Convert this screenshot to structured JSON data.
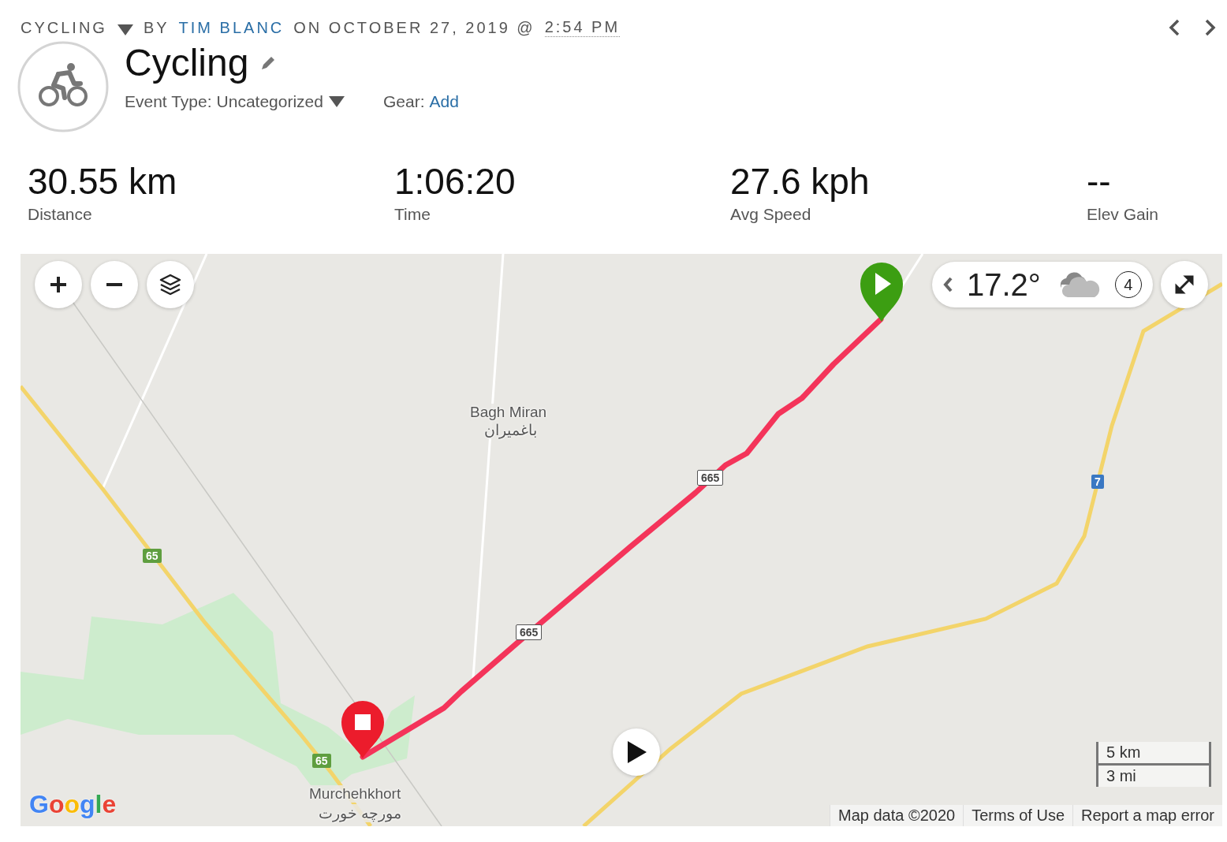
{
  "breadcrumb": {
    "activity": "CYCLING",
    "by": "BY",
    "author": "TIM BLANC",
    "date": "ON OCTOBER 27, 2019 @",
    "time": "2:54 PM"
  },
  "title": "Cycling",
  "event_type": {
    "label": "Event Type:",
    "value": "Uncategorized"
  },
  "gear": {
    "label": "Gear:",
    "value": "Add"
  },
  "stats": [
    {
      "value": "30.55 km",
      "label": "Distance"
    },
    {
      "value": "1:06:20",
      "label": "Time"
    },
    {
      "value": "27.6 kph",
      "label": "Avg Speed"
    },
    {
      "value": "--",
      "label": "Elev Gain"
    }
  ],
  "map": {
    "weather": {
      "temperature": "17.2°",
      "wind": "4"
    },
    "labels": [
      {
        "kind": "place",
        "text": "Bagh Miran"
      },
      {
        "kind": "place",
        "text": "باغمیران"
      },
      {
        "kind": "place",
        "text": "Murchehkhort"
      },
      {
        "kind": "place",
        "text": "مورچه خورت"
      },
      {
        "kind": "shield",
        "text": "65",
        "color": "#5f9e3f"
      },
      {
        "kind": "shield",
        "text": "65",
        "color": "#5f9e3f"
      },
      {
        "kind": "shield",
        "text": "7",
        "color": "#3a78c3"
      },
      {
        "kind": "shield",
        "text": "665",
        "color": "#ffffff"
      },
      {
        "kind": "shield",
        "text": "665",
        "color": "#ffffff"
      }
    ],
    "logo": "Google",
    "scale": [
      "5 km",
      "3 mi"
    ],
    "attribution": [
      "Map data ©2020",
      "Terms of Use",
      "Report a map error"
    ]
  }
}
